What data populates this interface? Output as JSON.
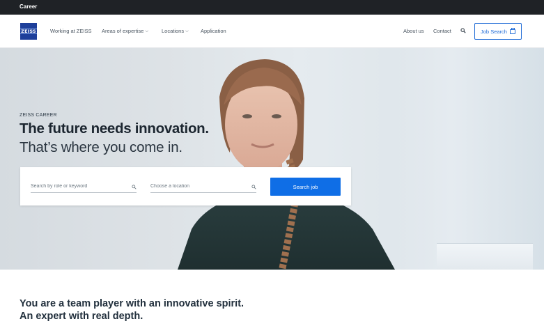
{
  "topbar": {
    "label": "Career"
  },
  "logo": {
    "text": "ZEISS",
    "color": "#1e3f9a"
  },
  "nav": {
    "items": [
      {
        "label": "Working at ZEISS",
        "has_dropdown": false
      },
      {
        "label": "Areas of expertise",
        "has_dropdown": true
      },
      {
        "label": "Locations",
        "has_dropdown": true
      },
      {
        "label": "Application",
        "has_dropdown": false
      }
    ],
    "right": [
      {
        "label": "About us"
      },
      {
        "label": "Contact"
      }
    ],
    "search_icon": "search-icon",
    "job_search": {
      "label": "Job Search",
      "icon": "briefcase-icon"
    }
  },
  "hero": {
    "eyebrow": "ZEISS CAREER",
    "title": "The future needs innovation.",
    "subtitle": "That’s where you come in.",
    "search": {
      "role_placeholder": "Search by role or keyword",
      "location_placeholder": "Choose a location",
      "button_label": "Search job"
    }
  },
  "section": {
    "line1": "You are a team player with an innovative spirit.",
    "line2": "An expert with real depth."
  },
  "colors": {
    "accent": "#0f6ee6",
    "topbar": "#1f2226",
    "heading": "#1c2630"
  }
}
